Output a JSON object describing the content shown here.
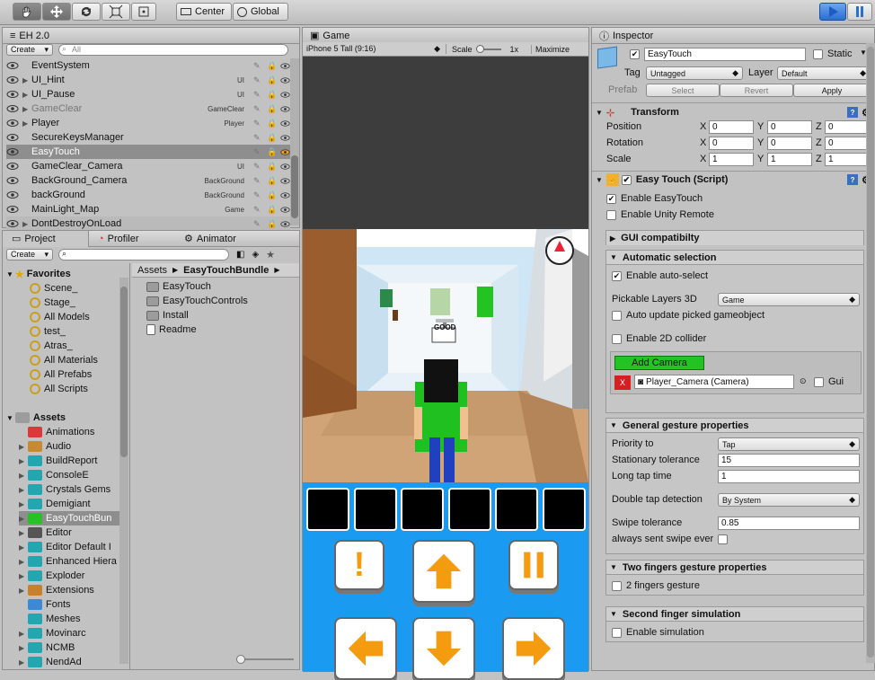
{
  "toolbar": {
    "center": "Center",
    "global": "Global"
  },
  "hierarchy": {
    "title": "EH 2.0",
    "create": "Create",
    "search_placeholder": "All",
    "rows": [
      {
        "name": "EventSystem",
        "tag": "",
        "greyed": false
      },
      {
        "name": "UI_Hint",
        "tag": "UI",
        "greyed": false
      },
      {
        "name": "UI_Pause",
        "tag": "UI",
        "greyed": false
      },
      {
        "name": "GameClear",
        "tag": "GameClear",
        "greyed": true
      },
      {
        "name": "Player",
        "tag": "Player",
        "greyed": false
      },
      {
        "name": "SecureKeysManager",
        "tag": "",
        "greyed": false
      },
      {
        "name": "EasyTouch",
        "tag": "",
        "greyed": false
      },
      {
        "name": "GameClear_Camera",
        "tag": "UI",
        "greyed": false
      },
      {
        "name": "BackGround_Camera",
        "tag": "BackGround",
        "greyed": false
      },
      {
        "name": "backGround",
        "tag": "BackGround",
        "greyed": false
      },
      {
        "name": "MainLight_Map",
        "tag": "Game",
        "greyed": false
      },
      {
        "name": "DontDestroyOnLoad",
        "tag": "",
        "greyed": false
      }
    ]
  },
  "project": {
    "tabs": [
      "Project",
      "Profiler",
      "Animator"
    ],
    "create": "Create",
    "favorites_label": "Favorites",
    "favorites": [
      "Scene_",
      "Stage_",
      "All Models",
      "test_",
      "Atras_",
      "All Materials",
      "All Prefabs",
      "All Scripts"
    ],
    "assets_label": "Assets",
    "assets": [
      "Animations",
      "Audio",
      "BuildReport",
      "ConsoleE",
      "Crystals Gems",
      "Demigiant",
      "EasyTouchBun",
      "Editor",
      "Editor Default I",
      "Enhanced Hiera",
      "Exploder",
      "Extensions",
      "Fonts",
      "Meshes",
      "Movinarc",
      "NCMB",
      "NendAd"
    ],
    "breadcrumb": [
      "Assets",
      "EasyTouchBundle"
    ],
    "contents": [
      "EasyTouch",
      "EasyTouchControls",
      "Install",
      "Readme"
    ]
  },
  "game": {
    "tab": "Game",
    "aspect": "iPhone 5 Tall (9:16)",
    "scale_label": "Scale",
    "scale_value": "1x",
    "maximize": "Maximize",
    "sign_text": "GOOD",
    "hint_glyph": "!"
  },
  "inspector": {
    "tab": "Inspector",
    "object_name": "EasyTouch",
    "static_label": "Static",
    "tag_label": "Tag",
    "tag_value": "Untagged",
    "layer_label": "Layer",
    "layer_value": "Default",
    "prefab_label": "Prefab",
    "select": "Select",
    "revert": "Revert",
    "apply": "Apply",
    "transform": {
      "title": "Transform",
      "rows": [
        {
          "label": "Position",
          "x": "0",
          "y": "0",
          "z": "0"
        },
        {
          "label": "Rotation",
          "x": "0",
          "y": "0",
          "z": "0"
        },
        {
          "label": "Scale",
          "x": "1",
          "y": "1",
          "z": "1"
        }
      ]
    },
    "script": {
      "title": "Easy Touch (Script)",
      "enable_easytouch": "Enable EasyTouch",
      "enable_unity_remote": "Enable Unity Remote"
    },
    "gui_compat": "GUI compatibilty",
    "auto_sel": {
      "title": "Automatic selection",
      "enable_auto": "Enable auto-select",
      "pickable_label": "Pickable Layers 3D",
      "pickable_value": "Game",
      "auto_update": "Auto update picked gameobject",
      "enable_2d": "Enable 2D collider",
      "add_camera": "Add Camera",
      "camera_value": "Player_Camera (Camera)",
      "gui": "Gui",
      "remove": "X"
    },
    "general": {
      "title": "General gesture properties",
      "priority_label": "Priority to",
      "priority_value": "Tap",
      "stationary_label": "Stationary tolerance",
      "stationary_value": "15",
      "longtap_label": "Long tap time",
      "longtap_value": "1",
      "double_label": "Double tap detection",
      "double_value": "By System",
      "swipe_label": "Swipe tolerance",
      "swipe_value": "0.85",
      "always_label": "always sent swipe ever"
    },
    "two_fingers": {
      "title": "Two fingers gesture properties",
      "label": "2 fingers gesture"
    },
    "second_finger": {
      "title": "Second finger simulation",
      "label": "Enable simulation"
    }
  },
  "colors": {
    "accent": "#2a74d6",
    "green": "#22c322",
    "sky": "#1a9af0",
    "orange": "#f59b10"
  }
}
